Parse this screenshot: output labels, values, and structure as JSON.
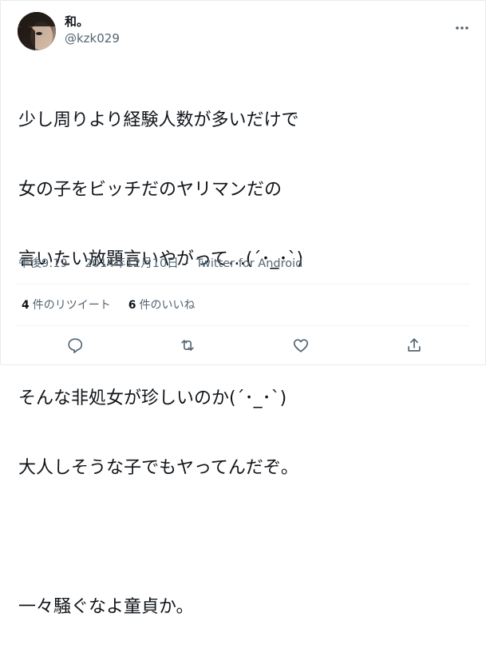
{
  "user": {
    "display_name": "和。",
    "handle": "@kzk029",
    "avatar_icon": "user-avatar"
  },
  "tweet": {
    "lines": [
      "少し周りより経験人数が多いだけで",
      "女の子をビッチだのヤリマンだの",
      "言いたい放題言いやがって…(´･_･`)",
      "",
      "そんな非処女が珍しいのか(´･_･`)",
      "大人しそうな子でもヤってんだぞ。",
      "",
      "一々騒ぐなよ童貞か。"
    ]
  },
  "meta": {
    "time": "午後9:19",
    "separator": "·",
    "date": "2014年12月10日",
    "source": "Twitter for Android"
  },
  "stats": {
    "retweets_count": "4",
    "retweets_label": "件のリツイート",
    "likes_count": "6",
    "likes_label": "件のいいね"
  },
  "actions": {
    "reply_icon": "reply-icon",
    "retweet_icon": "retweet-icon",
    "like_icon": "heart-icon",
    "share_icon": "share-icon",
    "more_icon": "more-options-icon"
  },
  "colors": {
    "text": "#0f1419",
    "secondary": "#536471",
    "divider": "#eff3f4",
    "icon": "#536471"
  }
}
